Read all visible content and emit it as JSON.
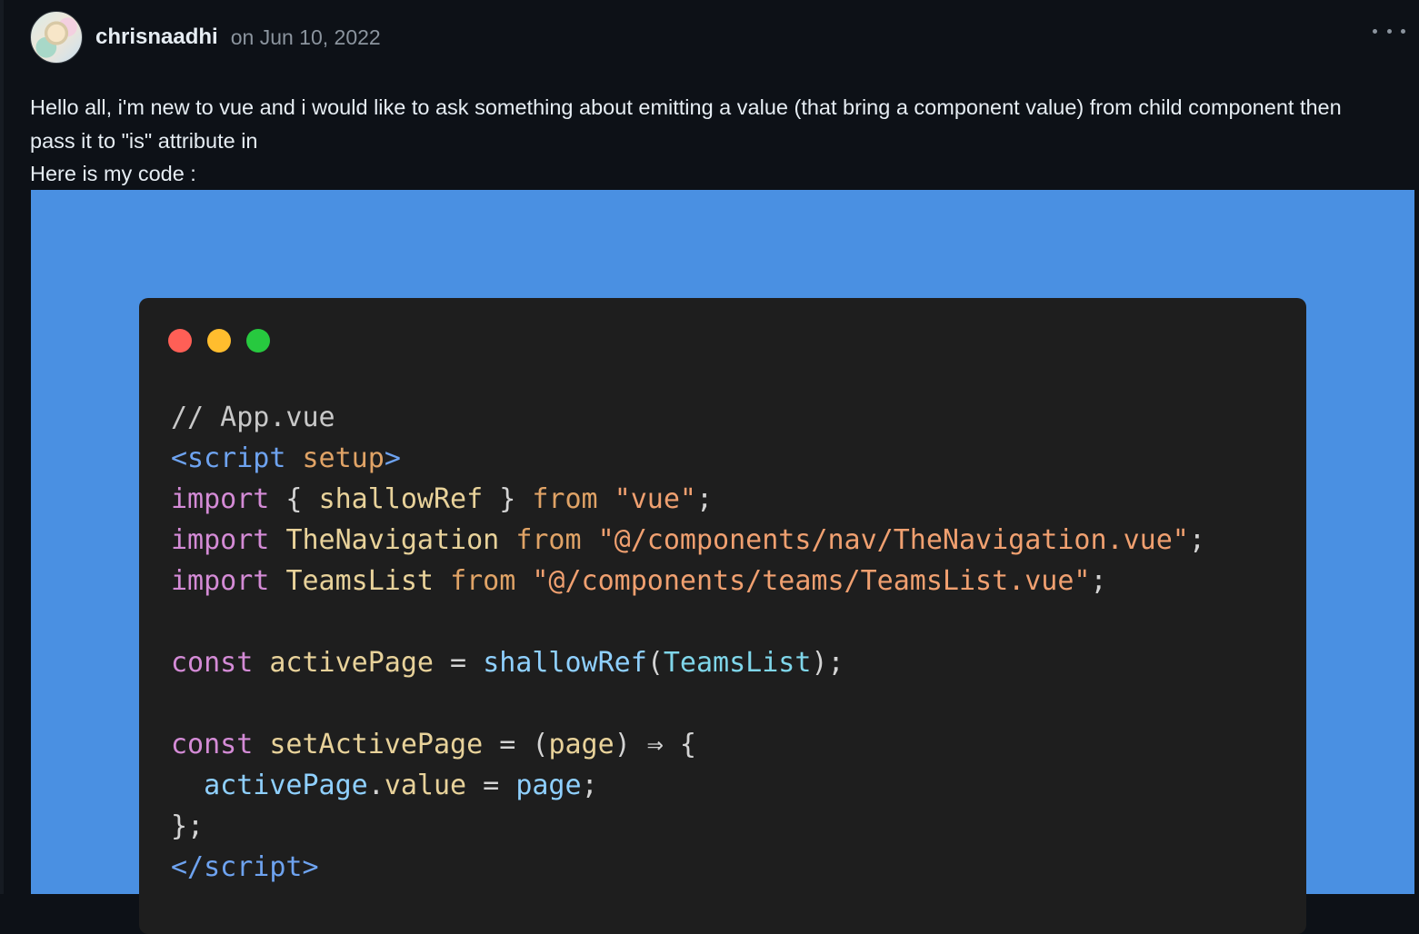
{
  "post": {
    "username": "chrisnaadhi",
    "date": "on Jun 10, 2022",
    "body_lines": [
      "Hello all, i'm new to vue and i would like to ask something about emitting a value (that bring a component value) from child component then",
      "pass it to \"is\" attribute in",
      "Here is my code :"
    ]
  },
  "code_image": {
    "background_color": "#4a90e2",
    "window_color": "#1e1e1e",
    "traffic_lights": [
      "#ff5f56",
      "#ffbd2e",
      "#27c93f"
    ],
    "lines": [
      [
        {
          "t": "// App.vue",
          "c": "c-comment"
        }
      ],
      [
        {
          "t": "<script",
          "c": "c-tag"
        },
        {
          "t": " ",
          "c": "c-plain"
        },
        {
          "t": "setup",
          "c": "c-attr"
        },
        {
          "t": ">",
          "c": "c-tag"
        }
      ],
      [
        {
          "t": "import",
          "c": "c-kw"
        },
        {
          "t": " { ",
          "c": "c-plain"
        },
        {
          "t": "shallowRef",
          "c": "c-def"
        },
        {
          "t": " } ",
          "c": "c-plain"
        },
        {
          "t": "from",
          "c": "c-attr"
        },
        {
          "t": " ",
          "c": "c-plain"
        },
        {
          "t": "\"vue\"",
          "c": "c-str"
        },
        {
          "t": ";",
          "c": "c-plain"
        }
      ],
      [
        {
          "t": "import",
          "c": "c-kw"
        },
        {
          "t": " ",
          "c": "c-plain"
        },
        {
          "t": "TheNavigation",
          "c": "c-def"
        },
        {
          "t": " ",
          "c": "c-plain"
        },
        {
          "t": "from",
          "c": "c-attr"
        },
        {
          "t": " ",
          "c": "c-plain"
        },
        {
          "t": "\"@/components/nav/TheNavigation.vue\"",
          "c": "c-str"
        },
        {
          "t": ";",
          "c": "c-plain"
        }
      ],
      [
        {
          "t": "import",
          "c": "c-kw"
        },
        {
          "t": " ",
          "c": "c-plain"
        },
        {
          "t": "TeamsList",
          "c": "c-def"
        },
        {
          "t": " ",
          "c": "c-plain"
        },
        {
          "t": "from",
          "c": "c-attr"
        },
        {
          "t": " ",
          "c": "c-plain"
        },
        {
          "t": "\"@/components/teams/TeamsList.vue\"",
          "c": "c-str"
        },
        {
          "t": ";",
          "c": "c-plain"
        }
      ],
      [],
      [
        {
          "t": "const",
          "c": "c-const"
        },
        {
          "t": " ",
          "c": "c-plain"
        },
        {
          "t": "activePage",
          "c": "c-def"
        },
        {
          "t": " = ",
          "c": "c-plain"
        },
        {
          "t": "shallowRef",
          "c": "c-fn"
        },
        {
          "t": "(",
          "c": "c-plain"
        },
        {
          "t": "TeamsList",
          "c": "c-cls"
        },
        {
          "t": ");",
          "c": "c-plain"
        }
      ],
      [],
      [
        {
          "t": "const",
          "c": "c-const"
        },
        {
          "t": " ",
          "c": "c-plain"
        },
        {
          "t": "setActivePage",
          "c": "c-def"
        },
        {
          "t": " = (",
          "c": "c-plain"
        },
        {
          "t": "page",
          "c": "c-def"
        },
        {
          "t": ") ⇒ {",
          "c": "c-plain"
        }
      ],
      [
        {
          "t": "  ",
          "c": "c-plain"
        },
        {
          "t": "activePage",
          "c": "c-var"
        },
        {
          "t": ".",
          "c": "c-plain"
        },
        {
          "t": "value",
          "c": "c-def"
        },
        {
          "t": " = ",
          "c": "c-plain"
        },
        {
          "t": "page",
          "c": "c-var"
        },
        {
          "t": ";",
          "c": "c-plain"
        }
      ],
      [
        {
          "t": "};",
          "c": "c-plain"
        }
      ],
      [
        {
          "t": "</",
          "c": "c-tag"
        },
        {
          "t": "script",
          "c": "c-tag"
        },
        {
          "t": ">",
          "c": "c-tag"
        }
      ]
    ]
  }
}
